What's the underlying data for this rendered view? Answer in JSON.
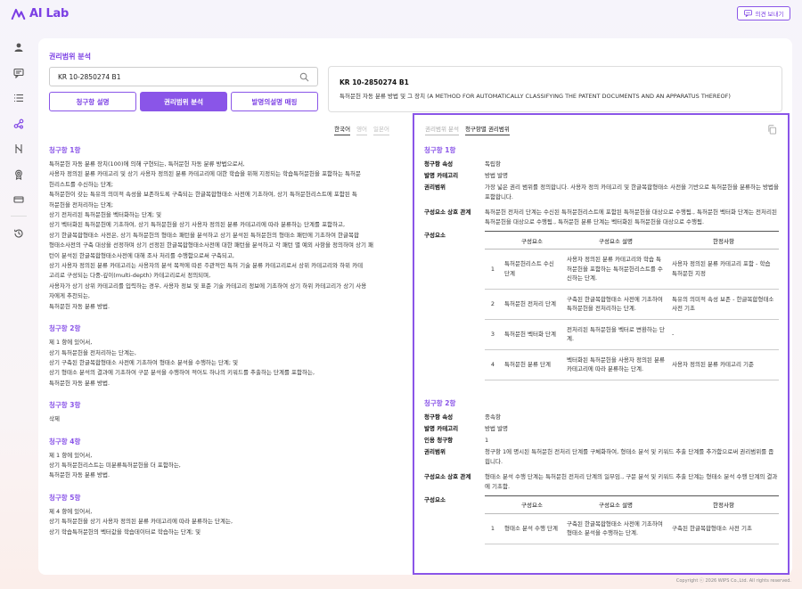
{
  "app": {
    "logo_text": "AI Lab",
    "feedback_label": "의견 보내기"
  },
  "nav": {
    "items": [
      {
        "icon": "user-icon"
      },
      {
        "icon": "chat-icon"
      },
      {
        "icon": "list-icon"
      },
      {
        "icon": "analysis-icon",
        "active": true
      },
      {
        "icon": "compare-icon"
      },
      {
        "icon": "award-icon"
      },
      {
        "icon": "card-icon"
      },
      {
        "icon": "history-icon"
      }
    ]
  },
  "page": {
    "section_title": "권리범위 분석",
    "search_value": "KR 10-2850274 B1",
    "buttons": {
      "claim_desc": "청구항 설명",
      "scope_analysis": "권리범위 분석",
      "desc_mapping": "발명의설명 매핑"
    },
    "patent": {
      "number": "KR 10-2850274 B1",
      "title": "특허문헌 자동 분류 방법 및 그 장치 (A METHOD FOR AUTOMATICALLY CLASSIFYING THE PATENT DOCUMENTS AND AN APPARATUS THEREOF)"
    }
  },
  "left": {
    "lang_tabs": [
      "한국어",
      "영어",
      "일본어"
    ],
    "claims": [
      {
        "title": "청구항 1항",
        "lines": [
          "특허문헌 자동 분류 장치(100)에 의해 구현되는, 특허문헌 자동 분류 방법으로서,",
          "사용자 정의된 분류 카테고리 및 상기 사용자 정의된 분류 카테고리에 대한 학습을 위해 지정되는 학습특허문헌을 포함하는 특허문",
          "헌리스트를 수신하는 단계;",
          "특허문헌이 갖는 특유의 의미적 속성을 보존하도록 구축되는 한글복합형태소 사전에 기초하여, 상기 특허문헌리스트에 포함된 특",
          "허문헌을 전처리하는 단계;",
          "상기 전처리된 특허문헌을 벡터화하는 단계; 및",
          "상기 벡터화된 특허문헌에 기초하여, 상기 특허문헌을 상기 사용자 정의된 분류 카테고리에 따라 분류하는 단계를 포함하고,",
          "상기 한글복합형태소 사전은, 상기 특허문헌의 형태소 패턴을 분석하고 상기 분석된 특허문헌의 형태소 패턴에 기초하여 한글복합",
          "형태소사전의 구축 대상을 선정하며 상기 선정된 한글복합형태소사전에 대한 패턴을 분석하고 각 패턴 별 예외 사항을 정의하며 상기 패",
          "턴이 분석된 한글복합형태소사전에 대해 조사 처리를 수행함으로써 구축되고,",
          "상기 사용자 정의된 분류 카테고리는 사용자의 분석 목적에 따른 주관적인 특허 기술 분류 카테고리로서 상위 카테고리와 하위 카테",
          "고리로 구성되는 다중-깊이(multi-depth) 카테고리로서 정의되며,",
          "사용자가 상기 상위 카테고리를 입력하는 경우, 사용자 정보 및 표준 기술 카테고리 정보에 기초하여 상기 하위 카테고리가 상기 사용",
          "자에게 추천되는,",
          "특허문헌 자동 분류 방법."
        ]
      },
      {
        "title": "청구항 2항",
        "lines": [
          "제 1 항에 있어서,",
          "상기 특허문헌을 전처리하는 단계는,",
          "상기 구축된 한글복합형태소 사전에 기초하여 형태소 분석을 수행하는 단계; 및",
          "상기 형태소 분석의 결과에 기초하여 구문 분석을 수행하여 적어도 하나의 키워드를 추출하는 단계를 포함하는,",
          "특허문헌 자동 분류 방법."
        ]
      },
      {
        "title": "청구항 3항",
        "lines": [
          "삭제"
        ]
      },
      {
        "title": "청구항 4항",
        "lines": [
          "제 1 항에 있어서,",
          "상기 특허문헌리스트는 미분류특허문헌을 더 포함하는,",
          "특허문헌 자동 분류 방법."
        ]
      },
      {
        "title": "청구항 5항",
        "lines": [
          "제 4 항에 있어서,",
          "상기 특허문헌을 상기 사용자 정의된 분류 카테고리에 따라 분류하는 단계는,",
          "상기 학습특허문헌의 벡터값을 학습데이터로 학습하는 단계; 및"
        ]
      }
    ]
  },
  "right": {
    "tabs": [
      "권리범위 분석",
      "청구항별 권리범위"
    ],
    "labels": {
      "category": "청구항 속성",
      "invention_category": "발명 카테고리",
      "cited_claim": "인용 청구항",
      "scope": "권리범위",
      "relation": "구성요소 상호 관계",
      "components": "구성요소"
    },
    "table_headers": [
      "구성요소",
      "구성요소 설명",
      "한정사항"
    ],
    "claims": [
      {
        "title": "청구항 1항",
        "category": "독립항",
        "invention_category": "방법 발명",
        "scope": "가장 넓은 권리 범위를 정의합니다. 사용자 정의 카테고리 및 한글복합형태소 사전을 기반으로 특허문헌을 분류하는 방법을 포함합니다.",
        "relation": "특허문헌 전처리 단계는 수신된 특허문헌리스트에 포함된 특허문헌을 대상으로 수행됨., 특허문헌 벡터화 단계는 전처리된 특허문헌을 대상으로 수행됨., 특허문헌 분류 단계는 벡터화된 특허문헌을 대상으로 수행됨.",
        "components": [
          {
            "no": "1",
            "name": "특허문헌리스트 수신 단계",
            "desc": "사용자 정의된 분류 카테고리와 학습 특허문헌을 포함하는 특허문헌리스트를 수신하는 단계.",
            "limit": "사용자 정의된 분류 카테고리 포함 - 학습 특허문헌 지정"
          },
          {
            "no": "2",
            "name": "특허문헌 전처리 단계",
            "desc": "구축된 한글복합형태소 사전에 기초하여 특허문헌을 전처리하는 단계.",
            "limit": "특유의 의미적 속성 보존 - 한글복합형태소 사전 기초"
          },
          {
            "no": "3",
            "name": "특허문헌 벡터화 단계",
            "desc": "전처리된 특허문헌을 벡터로 변환하는 단계.",
            "limit": "-"
          },
          {
            "no": "4",
            "name": "특허문헌 분류 단계",
            "desc": "벡터화된 특허문헌을 사용자 정의된 분류 카테고리에 따라 분류하는 단계.",
            "limit": "사용자 정의된 분류 카테고리 기준"
          }
        ]
      },
      {
        "title": "청구항 2항",
        "category": "종속항",
        "invention_category": "방법 발명",
        "cited_claim": "1",
        "scope": "청구항 1에 명시된 특허문헌 전처리 단계를 구체화하여, 형태소 분석 및 키워드 추출 단계를 추가함으로써 권리범위를 좁힙니다.",
        "relation": "형태소 분석 수행 단계는 특허문헌 전처리 단계의 일부임., 구문 분석 및 키워드 추출 단계는 형태소 분석 수행 단계의 결과에 기초함.",
        "components": [
          {
            "no": "1",
            "name": "형태소 분석 수행 단계",
            "desc": "구축된 한글복합형태소 사전에 기초하여 형태소 분석을 수행하는 단계.",
            "limit": "구축된 한글복합형태소 사전 기초"
          }
        ]
      }
    ]
  },
  "footer": "Copyright ⓒ 2026 WIPS Co.,Ltd. All rights reserved."
}
